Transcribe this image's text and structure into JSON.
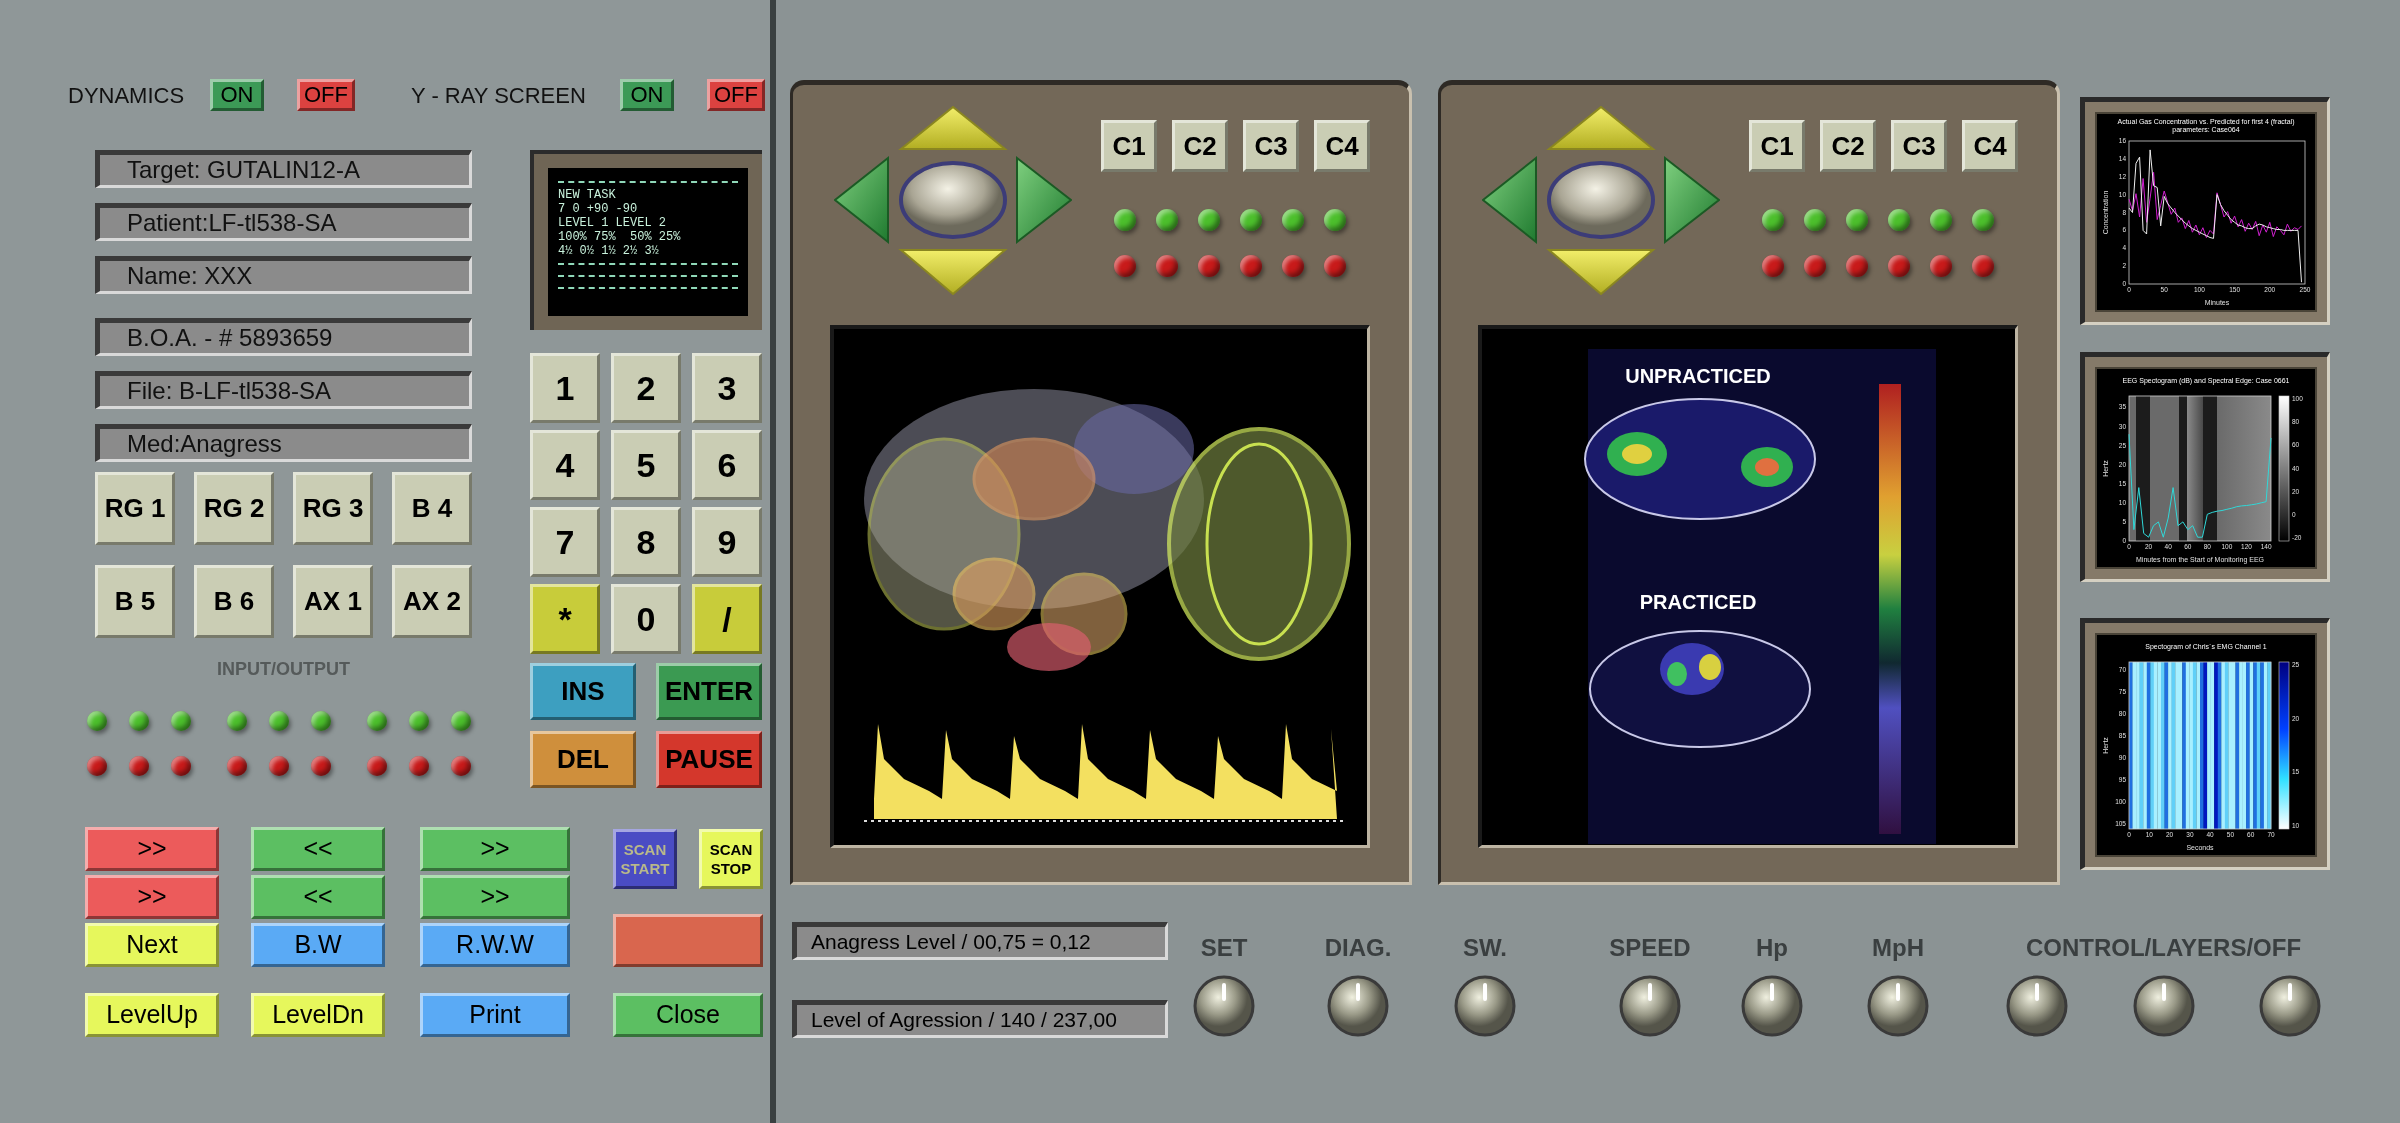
{
  "toggles": [
    {
      "label": "DYNAMICS",
      "buttons": [
        {
          "label": "ON",
          "kind": "on"
        },
        {
          "label": "OFF",
          "kind": "off"
        }
      ]
    },
    {
      "label": "Y - RAY SCREEN",
      "buttons": [
        {
          "label": "ON",
          "kind": "on"
        },
        {
          "label": "OFF",
          "kind": "off"
        }
      ]
    }
  ],
  "info_groups": [
    [
      "Target: GUTALIN12-A",
      "Patient:LF-tl538-SA",
      "Name: XXX"
    ],
    [
      "B.O.A. -  # 5893659",
      "File: B-LF-tl538-SA",
      "Med:Anagress"
    ]
  ],
  "function_buttons": [
    "RG 1",
    "RG 2",
    "RG 3",
    "B 4",
    "B 5",
    "B 6",
    "AX 1",
    "AX 2"
  ],
  "io_label": "INPUT/OUTPUT",
  "indicator_rows": [
    {
      "color": "#4cbf2c"
    },
    {
      "color": "#c81a1a"
    }
  ],
  "monitor": {
    "lines": [
      "NEW TASK",
      "7 0 +90 -90",
      "LEVEL 1 LEVEL 2",
      "100% 75%  50% 25%",
      "4½ 0½ 1½ 2½ 3½"
    ]
  },
  "keypad": [
    {
      "label": "1",
      "kind": "khaki"
    },
    {
      "label": "2",
      "kind": "khaki"
    },
    {
      "label": "3",
      "kind": "khaki"
    },
    {
      "label": "4",
      "kind": "khaki"
    },
    {
      "label": "5",
      "kind": "khaki"
    },
    {
      "label": "6",
      "kind": "khaki"
    },
    {
      "label": "7",
      "kind": "khaki"
    },
    {
      "label": "8",
      "kind": "khaki"
    },
    {
      "label": "9",
      "kind": "khaki"
    },
    {
      "label": "*",
      "kind": "lime"
    },
    {
      "label": "0",
      "kind": "khaki"
    },
    {
      "label": "/",
      "kind": "lime"
    }
  ],
  "edit_keys": [
    {
      "label": "INS",
      "kind": "teal"
    },
    {
      "label": "ENTER",
      "kind": "emerald"
    },
    {
      "label": "DEL",
      "kind": "orange"
    },
    {
      "label": "PAUSE",
      "kind": "crimson"
    }
  ],
  "control_columns": [
    [
      {
        "label": ">>",
        "kind": "red"
      },
      {
        "label": ">>",
        "kind": "red"
      },
      {
        "label": "Next",
        "kind": "yellow"
      },
      {
        "label": "LevelUp",
        "kind": "yellow"
      }
    ],
    [
      {
        "label": "<<",
        "kind": "green"
      },
      {
        "label": "<<",
        "kind": "green"
      },
      {
        "label": "B.W",
        "kind": "blue"
      },
      {
        "label": "LevelDn",
        "kind": "yellow"
      }
    ],
    [
      {
        "label": ">>",
        "kind": "green"
      },
      {
        "label": ">>",
        "kind": "green"
      },
      {
        "label": "R.W.W",
        "kind": "blue"
      },
      {
        "label": "Print",
        "kind": "blue"
      }
    ]
  ],
  "scan_buttons": [
    {
      "label": "SCAN START",
      "kind": "navy"
    },
    {
      "label": "SCAN STOP",
      "kind": "yellow"
    }
  ],
  "close_button": {
    "label": "Close",
    "kind": "green"
  },
  "viewers": [
    {
      "channel_buttons": [
        "C1",
        "C2",
        "C3",
        "C4"
      ],
      "indicator_rows": [
        {
          "color": "#4cbf2c"
        },
        {
          "color": "#c81a1a"
        }
      ]
    },
    {
      "channel_buttons": [
        "C1",
        "C2",
        "C3",
        "C4"
      ],
      "indicator_rows": [
        {
          "color": "#4cbf2c"
        },
        {
          "color": "#c81a1a"
        }
      ],
      "display_labels": [
        "UNPRACTICED",
        "PRACTICED"
      ]
    }
  ],
  "plots": [
    {
      "kind": "line",
      "chart_data": {
        "type": "line",
        "title": "Actual Gas Concentration vs. Predicted for first 4 (fractal) parameters: Case064",
        "xlabel": "Minutes",
        "ylabel": "Concentration",
        "x": [
          0,
          5,
          10,
          15,
          20,
          25,
          30,
          35,
          40,
          45,
          50,
          55,
          60,
          65,
          70,
          75,
          80,
          85,
          90,
          95,
          100,
          105,
          110,
          115,
          120,
          125,
          130,
          135,
          140,
          145,
          150,
          155,
          160,
          165,
          170,
          175,
          180,
          185,
          190,
          195,
          200,
          205,
          210,
          215,
          220,
          225,
          230,
          235,
          240,
          245
        ],
        "series": [
          {
            "color": "#d020d0",
            "values": [
              9.5,
              8.2,
              10.1,
              7.5,
              11.8,
              6.9,
              9.6,
              12.5,
              7.2,
              8.8,
              10.4,
              9.1,
              7.8,
              8.5,
              6.9,
              7.4,
              6.2,
              7.1,
              5.8,
              6.6,
              5.5,
              6.3,
              5.2,
              6.0,
              5.6,
              10.2,
              8.9,
              7.5,
              8.1,
              6.8,
              7.6,
              6.4,
              7.2,
              5.9,
              6.8,
              6.1,
              7.0,
              5.4,
              6.6,
              5.8,
              6.9,
              5.3,
              6.4,
              6.0,
              5.5,
              6.7,
              5.9,
              6.3,
              6.1,
              6.5
            ]
          },
          {
            "color": "#f0f0f0",
            "values": [
              8.5,
              8.0,
              13.5,
              14.2,
              6.0,
              5.6,
              15.0,
              11.0,
              10.8,
              6.5,
              9.8,
              9.0,
              8.5,
              8.0,
              7.6,
              7.2,
              6.8,
              6.5,
              6.2,
              6.0,
              5.8,
              5.6,
              5.4,
              5.2,
              5.1,
              10.0,
              8.9,
              8.2,
              7.7,
              7.2,
              6.9,
              6.6,
              6.5,
              6.3,
              6.2,
              6.2,
              6.5,
              6.7,
              6.6,
              6.4,
              6.3,
              6.2,
              6.1,
              6.1,
              6.0,
              6.0,
              6.0,
              6.0,
              6.0,
              0.2
            ]
          }
        ],
        "xlim": [
          0,
          250
        ],
        "ylim": [
          0,
          16
        ],
        "xticks": [
          0,
          50,
          100,
          150,
          200,
          250
        ],
        "yticks": [
          0,
          2,
          4,
          6,
          8,
          10,
          12,
          14,
          16
        ]
      }
    },
    {
      "kind": "grayscale",
      "chart_data": {
        "type": "line",
        "title": "EEG Spectogram (dB) and Spectral Edge: Case 0661",
        "xlabel": "Minutes from the Start of Monitoring EEG",
        "ylabel": "Hertz",
        "x": [
          0,
          5,
          10,
          15,
          20,
          25,
          30,
          35,
          40,
          45,
          50,
          55,
          60,
          65,
          70,
          75,
          80,
          85,
          90,
          95,
          100,
          105,
          110,
          115,
          120,
          125,
          130,
          135,
          140,
          145
        ],
        "series": [
          {
            "color": "#30d8d8",
            "values": [
              28,
              3,
              14,
              2,
              1,
              4,
              5,
              1,
              6,
              14,
              4,
              5,
              3,
              4,
              1,
              1,
              7,
              7.5,
              7.8,
              8,
              8.3,
              8.6,
              9,
              9.2,
              9.3,
              9.5,
              9.7,
              10,
              10.3,
              27
            ]
          }
        ],
        "xlim": [
          0,
          145
        ],
        "ylim": [
          0,
          38
        ],
        "xticks": [
          0,
          20,
          40,
          60,
          80,
          100,
          120,
          140
        ],
        "yticks": [
          0,
          5,
          10,
          15,
          20,
          25,
          30,
          35
        ]
      },
      "colorbar_ticks": [
        "100",
        "80",
        "60",
        "40",
        "20",
        "0",
        "-20"
      ]
    },
    {
      "kind": "bluescale",
      "title": "Spectogram of Chris`s EMG Channel 1",
      "xlabel": "Seconds",
      "ylabel": "Hertz",
      "xticks": [
        "0",
        "10",
        "20",
        "30",
        "40",
        "50",
        "60",
        "70"
      ],
      "yticks": [
        "70",
        "75",
        "80",
        "85",
        "90",
        "95",
        "100",
        "105"
      ],
      "colorbar_ticks": [
        "25",
        "20",
        "15",
        "10"
      ]
    }
  ],
  "readouts": [
    "Anagress Level / 00,75 = 0,12",
    "Level of Agression / 140 / 237,00"
  ],
  "knobs": [
    {
      "label": "SET"
    },
    {
      "label": "DIAG."
    },
    {
      "label": "SW."
    },
    {
      "label": "SPEED"
    },
    {
      "label": "Hp"
    },
    {
      "label": "MpH"
    }
  ],
  "knob_group": {
    "label": "CONTROL/LAYERS/OFF"
  }
}
